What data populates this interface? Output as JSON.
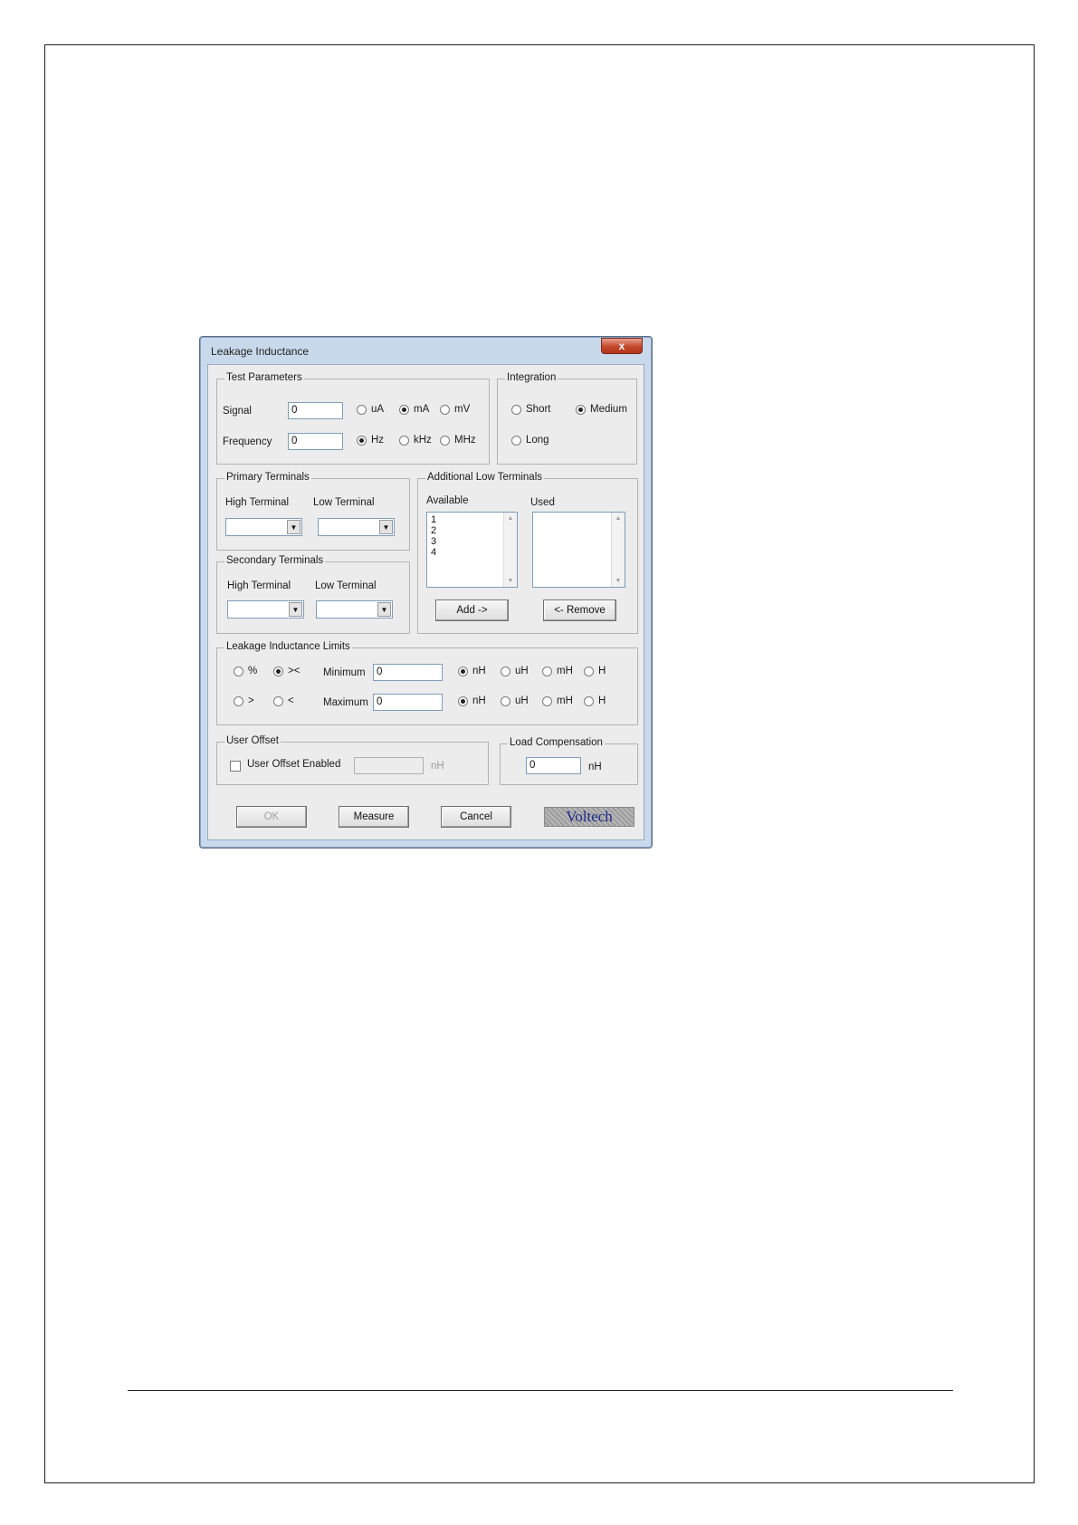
{
  "dialog": {
    "title": "Leakage Inductance",
    "close_label": "x"
  },
  "test_parameters": {
    "legend": "Test Parameters",
    "signal_label": "Signal",
    "signal_value": "0",
    "frequency_label": "Frequency",
    "frequency_value": "0",
    "signal_units": [
      {
        "label": "uA",
        "selected": false
      },
      {
        "label": "mA",
        "selected": true
      },
      {
        "label": "mV",
        "selected": false
      }
    ],
    "frequency_units": [
      {
        "label": "Hz",
        "selected": true
      },
      {
        "label": "kHz",
        "selected": false
      },
      {
        "label": "MHz",
        "selected": false
      }
    ]
  },
  "integration": {
    "legend": "Integration",
    "options": [
      {
        "label": "Short",
        "selected": false
      },
      {
        "label": "Medium",
        "selected": true
      },
      {
        "label": "Long",
        "selected": false
      }
    ]
  },
  "primary_terminals": {
    "legend": "Primary Terminals",
    "high_label": "High Terminal",
    "low_label": "Low Terminal"
  },
  "secondary_terminals": {
    "legend": "Secondary Terminals",
    "high_label": "High Terminal",
    "low_label": "Low Terminal"
  },
  "additional_low_terminals": {
    "legend": "Additional Low Terminals",
    "available_label": "Available",
    "used_label": "Used",
    "available_items": [
      "1",
      "2",
      "3",
      "4"
    ],
    "used_items": [],
    "add_label": "Add ->",
    "remove_label": "<- Remove"
  },
  "limits": {
    "legend": "Leakage Inductance Limits",
    "mode_options": [
      {
        "label": "%",
        "selected": false
      },
      {
        "label": "><",
        "selected": true
      },
      {
        "label": ">",
        "selected": false
      },
      {
        "label": "<",
        "selected": false
      }
    ],
    "minimum_label": "Minimum",
    "minimum_value": "0",
    "maximum_label": "Maximum",
    "maximum_value": "0",
    "min_units": [
      {
        "label": "nH",
        "selected": true
      },
      {
        "label": "uH",
        "selected": false
      },
      {
        "label": "mH",
        "selected": false
      },
      {
        "label": "H",
        "selected": false
      }
    ],
    "max_units": [
      {
        "label": "nH",
        "selected": true
      },
      {
        "label": "uH",
        "selected": false
      },
      {
        "label": "mH",
        "selected": false
      },
      {
        "label": "H",
        "selected": false
      }
    ]
  },
  "user_offset": {
    "legend": "User Offset",
    "checkbox_label": "User Offset Enabled",
    "enabled": false,
    "value": "",
    "unit": "nH"
  },
  "load_compensation": {
    "legend": "Load Compensation",
    "value": "0",
    "unit": "nH"
  },
  "footer": {
    "ok_label": "OK",
    "measure_label": "Measure",
    "cancel_label": "Cancel",
    "logo_text": "Voltech"
  }
}
